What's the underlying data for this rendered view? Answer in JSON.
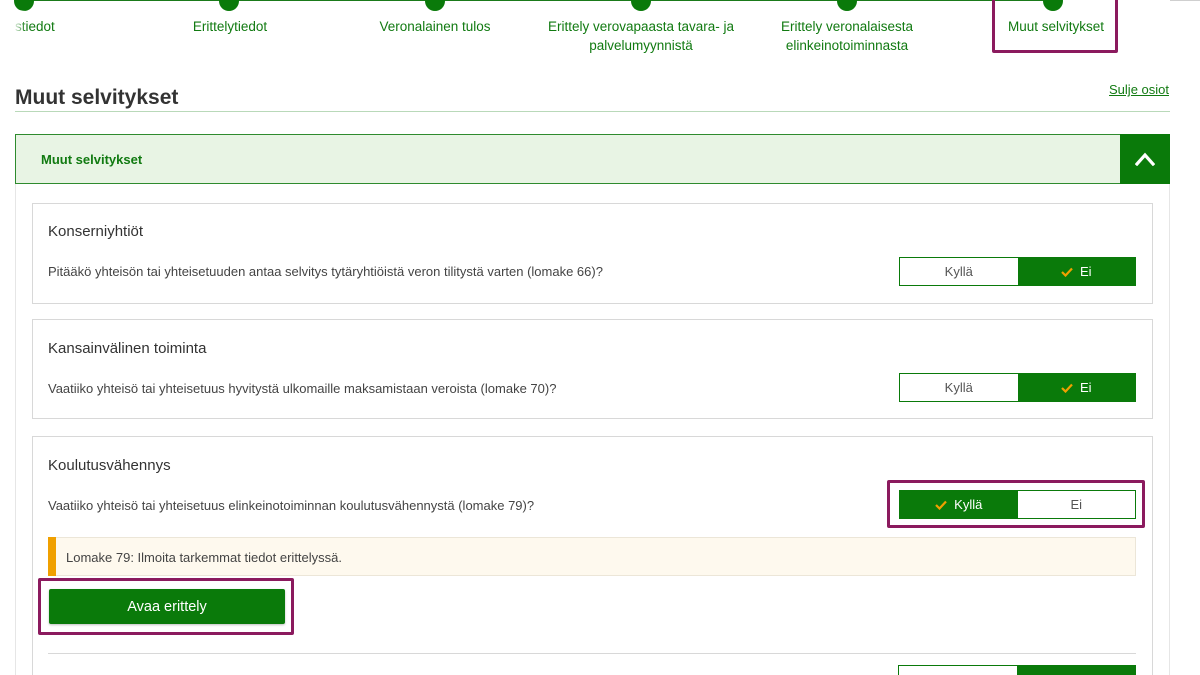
{
  "stepper": {
    "steps": [
      {
        "label": "stiedot"
      },
      {
        "label": "Erittelytiedot"
      },
      {
        "label": "Veronalainen tulos"
      },
      {
        "label": "Erittely verovapaasta tavara- ja palvelumyynnistä"
      },
      {
        "label": "Erittely veronalaisesta elinkeinotoiminnasta"
      },
      {
        "label": "Muut selvitykset"
      }
    ]
  },
  "page": {
    "title": "Muut selvitykset",
    "close_sections": "Sulje osiot"
  },
  "accordion": {
    "title": "Muut selvitykset",
    "toggle_icon": "chevron-up-icon"
  },
  "sections": [
    {
      "title": "Konserniyhtiöt",
      "question": "Pitääkö yhteisön tai yhteisetuuden antaa selvitys tytäryhtiöistä veron tilitystä varten (lomake 66)?",
      "yes_label": "Kyllä",
      "no_label": "Ei",
      "selected": "Ei"
    },
    {
      "title": "Kansainvälinen toiminta",
      "question": "Vaatiiko yhteisö tai yhteisetuus hyvitystä ulkomaille maksamistaan veroista (lomake 70)?",
      "yes_label": "Kyllä",
      "no_label": "Ei",
      "selected": "Ei"
    },
    {
      "title": "Koulutusvähennys",
      "question": "Vaatiiko yhteisö tai yhteisetuus elinkeinotoiminnan koulutusvähennystä (lomake 79)?",
      "yes_label": "Kyllä",
      "no_label": "Ei",
      "selected": "Kyllä",
      "notice": "Lomake 79: Ilmoita tarkemmat tiedot erittelyssä.",
      "action_label": "Avaa erittely"
    }
  ],
  "colors": {
    "primary_green": "#0a7a0a",
    "link_green": "#117a11",
    "highlight": "#8b1a5e",
    "notice_accent": "#f0a000"
  }
}
